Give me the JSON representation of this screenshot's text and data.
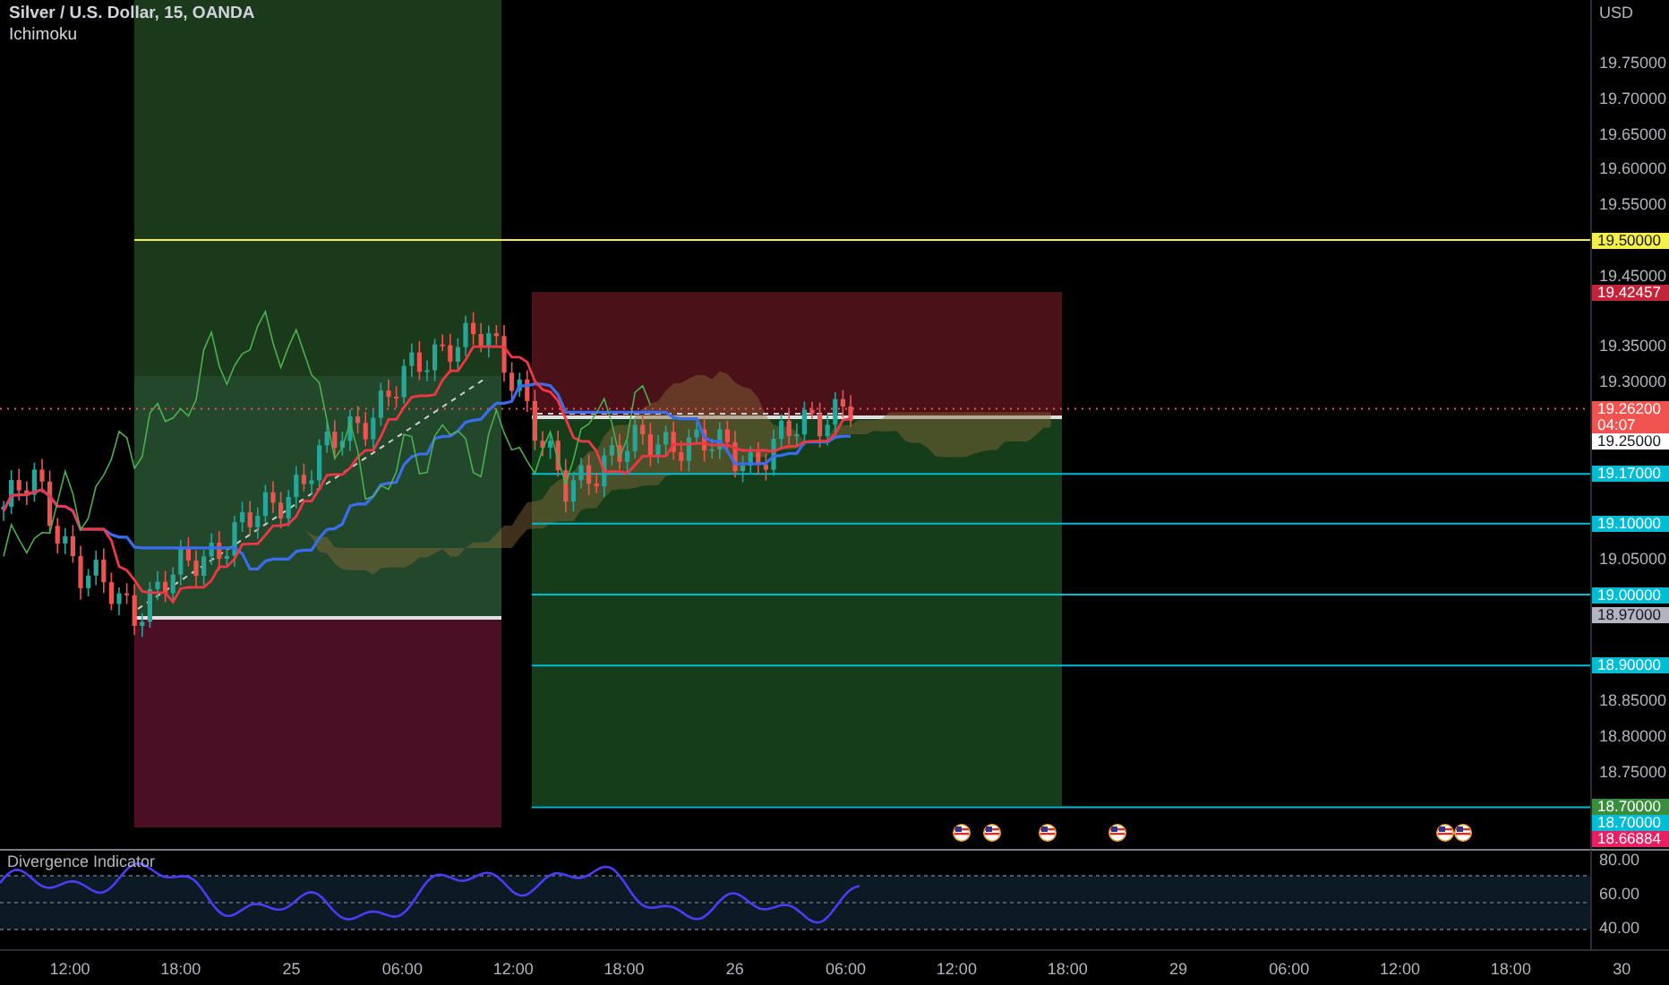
{
  "header": {
    "symbol": "Silver / U.S. Dollar, 15, OANDA",
    "indicator": "Ichimoku"
  },
  "price_axis": {
    "currency": "USD",
    "ticks": [
      "19.75000",
      "19.70000",
      "19.65000",
      "19.60000",
      "19.55000",
      "19.45000",
      "19.35000",
      "19.30000",
      "19.05000",
      "18.85000",
      "18.80000",
      "18.75000"
    ]
  },
  "price_labels": [
    {
      "kind": "hline",
      "text": "19.50000",
      "color": "#f5ef4b"
    },
    {
      "kind": "position",
      "text": "19.42457",
      "color": "#c4243a"
    },
    {
      "kind": "price",
      "text": "19.26200",
      "countdown": "04:07",
      "color": "#f05350"
    },
    {
      "kind": "position",
      "text": "19.25000",
      "color": "#ffffff"
    },
    {
      "kind": "target",
      "text": "19.17000",
      "color": "#00bcd4"
    },
    {
      "kind": "target",
      "text": "19.10000",
      "color": "#00bcd4"
    },
    {
      "kind": "target",
      "text": "19.00000",
      "color": "#00bcd4"
    },
    {
      "kind": "position",
      "text": "18.97000",
      "color": "#b2b5be"
    },
    {
      "kind": "target",
      "text": "18.90000",
      "color": "#00bcd4"
    },
    {
      "kind": "position",
      "text": "18.70000",
      "color": "#388e3c"
    },
    {
      "kind": "target",
      "text": "18.70000",
      "color": "#00bcd4"
    },
    {
      "kind": "position",
      "text": "18.66884",
      "color": "#e91e63"
    }
  ],
  "indicator_pane": {
    "title": "Divergence Indicator",
    "ticks": [
      "80.00",
      "60.00",
      "40.00"
    ]
  },
  "time_axis": [
    "12:00",
    "18:00",
    "25",
    "06:00",
    "12:00",
    "18:00",
    "26",
    "06:00",
    "12:00",
    "18:00",
    "29",
    "06:00",
    "12:00",
    "18:00",
    "30"
  ]
}
